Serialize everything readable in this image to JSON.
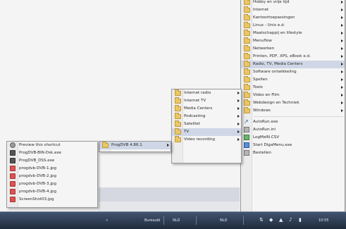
{
  "desktop": {
    "taskbar": {
      "toolbar_label": "Bureaubl",
      "toolbar_arrow": "«",
      "lang1": "NLD",
      "lang2": "NLD",
      "time": "10:55"
    },
    "file_menu": [
      {
        "label": "Preview this shortcut",
        "icon": "file-gray-icon"
      },
      {
        "label": "ProgDVB-BIN-Dsk.exe",
        "icon": "file-dark-icon"
      },
      {
        "label": "ProgDVB_DSS.exe",
        "icon": "file-dark-icon"
      },
      {
        "label": "progdvb-DVB-1.jpg",
        "icon": "image-icon"
      },
      {
        "label": "progdvb-DVB-2.jpg",
        "icon": "image-icon"
      },
      {
        "label": "progdvb-DVB-3.jpg",
        "icon": "image-icon"
      },
      {
        "label": "progdvb-DVB-4.jpg",
        "icon": "image-icon"
      },
      {
        "label": "ScreenShot03.jpg",
        "icon": "image-icon"
      }
    ],
    "progdvb_menu": [
      {
        "label": "ProgDVB 4.86.1",
        "icon": "folder-icon",
        "submenu": true
      }
    ],
    "tv_menu": [
      {
        "label": "Internet radio",
        "icon": "folder-icon",
        "submenu": true
      },
      {
        "label": "Internet TV",
        "icon": "folder-icon",
        "submenu": true
      },
      {
        "label": "Media Centers",
        "icon": "folder-icon",
        "submenu": true
      },
      {
        "label": "Podcasting",
        "icon": "folder-icon",
        "submenu": true
      },
      {
        "label": "Satelliet",
        "icon": "folder-icon",
        "submenu": true
      },
      {
        "label": "TV",
        "icon": "folder-icon",
        "submenu": true
      },
      {
        "label": "Video recording",
        "icon": "folder-icon",
        "submenu": true
      }
    ],
    "main_menu": [
      {
        "label": "Hobby en vrije tijd",
        "icon": "folder-icon",
        "submenu": true
      },
      {
        "label": "Internet",
        "icon": "folder-icon",
        "submenu": true
      },
      {
        "label": "Kantoortoepassingen",
        "icon": "folder-icon",
        "submenu": true
      },
      {
        "label": "Linux - Unix e.d.",
        "icon": "folder-icon",
        "submenu": true
      },
      {
        "label": "Maatschappij en lifestyle",
        "icon": "folder-icon",
        "submenu": true
      },
      {
        "label": "Menuflow",
        "icon": "folder-icon",
        "submenu": true
      },
      {
        "label": "Netwerken",
        "icon": "folder-icon",
        "submenu": true
      },
      {
        "label": "Printen, PDF, XPS, eBook e.d.",
        "icon": "folder-icon",
        "submenu": true
      },
      {
        "label": "Radio, TV, Media Centers",
        "icon": "folder-icon",
        "submenu": true
      },
      {
        "label": "Software ontwikkeling",
        "icon": "folder-icon",
        "submenu": true
      },
      {
        "label": "Spellen",
        "icon": "folder-icon",
        "submenu": true
      },
      {
        "label": "Tools",
        "icon": "folder-icon",
        "submenu": true
      },
      {
        "label": "Video en Film",
        "icon": "folder-icon",
        "submenu": true
      },
      {
        "label": "Webdesign en Techniek",
        "icon": "folder-icon",
        "submenu": true
      },
      {
        "label": "Windows",
        "icon": "folder-icon",
        "submenu": true
      },
      {
        "label": "AutoRun.exe",
        "icon": "link-icon",
        "submenu": false
      },
      {
        "label": "AutoRun.ini",
        "icon": "app-gray-icon",
        "submenu": false
      },
      {
        "label": "LogMeIN.CSV",
        "icon": "app-green-icon",
        "submenu": false
      },
      {
        "label": "Start DigaMenu.exe",
        "icon": "app-blue-icon",
        "submenu": false
      },
      {
        "label": "Bestellen",
        "icon": "app-gray-icon",
        "submenu": false
      }
    ]
  }
}
